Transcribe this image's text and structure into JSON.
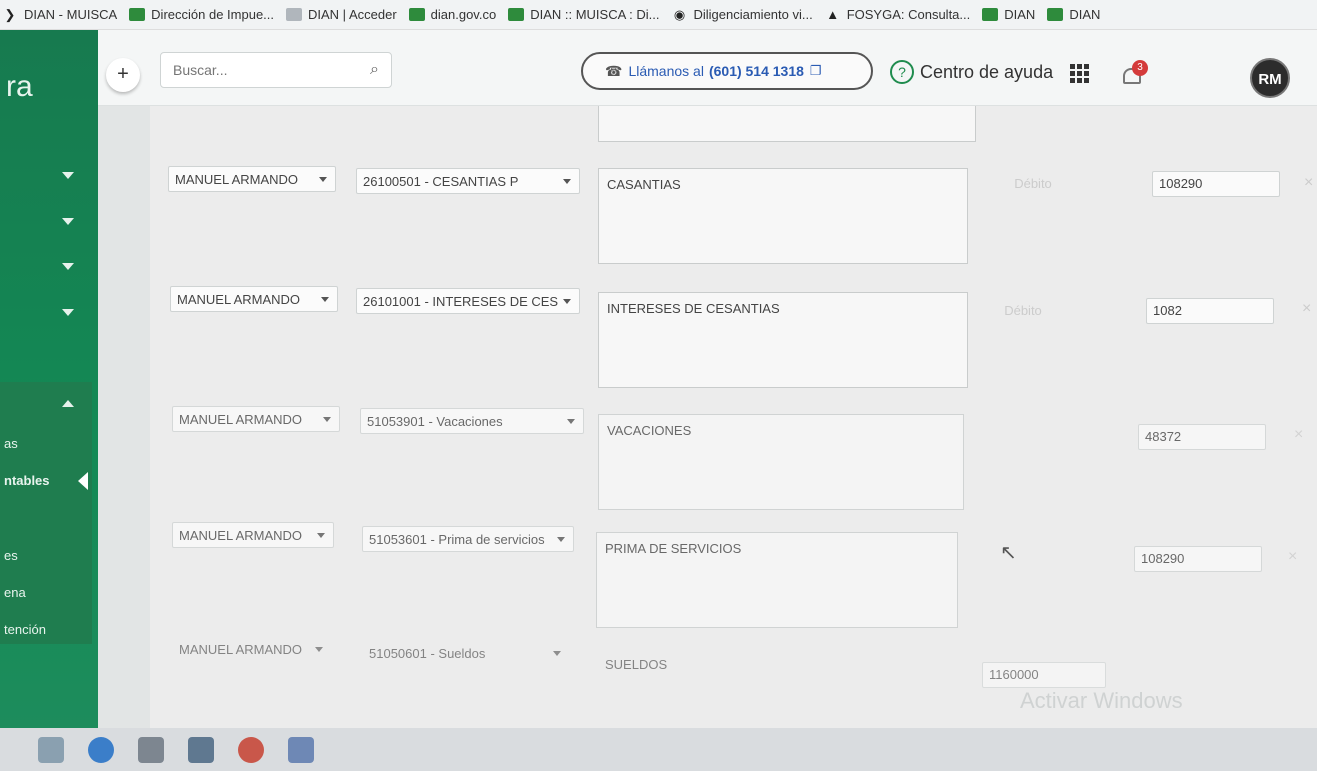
{
  "bookmarks": [
    {
      "label": "DIAN - MUISCA",
      "icon": "dark"
    },
    {
      "label": "Dirección de Impue...",
      "icon": "green"
    },
    {
      "label": "DIAN | Acceder",
      "icon": "gray"
    },
    {
      "label": "dian.gov.co",
      "icon": "green"
    },
    {
      "label": "DIAN :: MUISCA : Di...",
      "icon": "green"
    },
    {
      "label": "Diligenciamiento vi...",
      "icon": "dark"
    },
    {
      "label": "FOSYGA: Consulta...",
      "icon": "dark"
    },
    {
      "label": "DIAN",
      "icon": "green"
    },
    {
      "label": "DIAN",
      "icon": "green"
    }
  ],
  "sidebar": {
    "brand": "ra",
    "labels": [
      "as",
      "ntables",
      "es",
      "ena",
      "tención"
    ]
  },
  "toolbar": {
    "plus": "+",
    "search_placeholder": "Buscar...",
    "call_label": "Llámanos al",
    "call_number": "(601) 514 1318",
    "help_label": "Centro de ayuda",
    "notification_count": "3",
    "avatar_initials": "RM"
  },
  "rows": [
    {
      "name": "MANUEL ARMANDO",
      "account": "26100501 - CESANTIAS P",
      "description": "CASANTIAS",
      "side": "Débito",
      "amount": "108290"
    },
    {
      "name": "MANUEL ARMANDO",
      "account": "26101001 - INTERESES DE CES",
      "description": "INTERESES DE CESANTIAS",
      "side": "Débito",
      "amount": "1082"
    },
    {
      "name": "MANUEL ARMANDO",
      "account": "51053901 - Vacaciones",
      "description": "VACACIONES",
      "side": "",
      "amount": "48372"
    },
    {
      "name": "MANUEL ARMANDO",
      "account": "51053601 - Prima de servicios",
      "description": "PRIMA DE SERVICIOS",
      "side": "",
      "amount": "108290"
    },
    {
      "name": "MANUEL ARMANDO",
      "account": "51050601 - Sueldos",
      "description": "SUELDOS",
      "side": "",
      "amount": "1160000"
    }
  ],
  "watermark": "Activar Windows",
  "colors": {
    "sidebar_green": "#177a4f",
    "help_green": "#1f8c4e",
    "badge_red": "#d43b3b",
    "link_blue": "#2a5bb3"
  }
}
